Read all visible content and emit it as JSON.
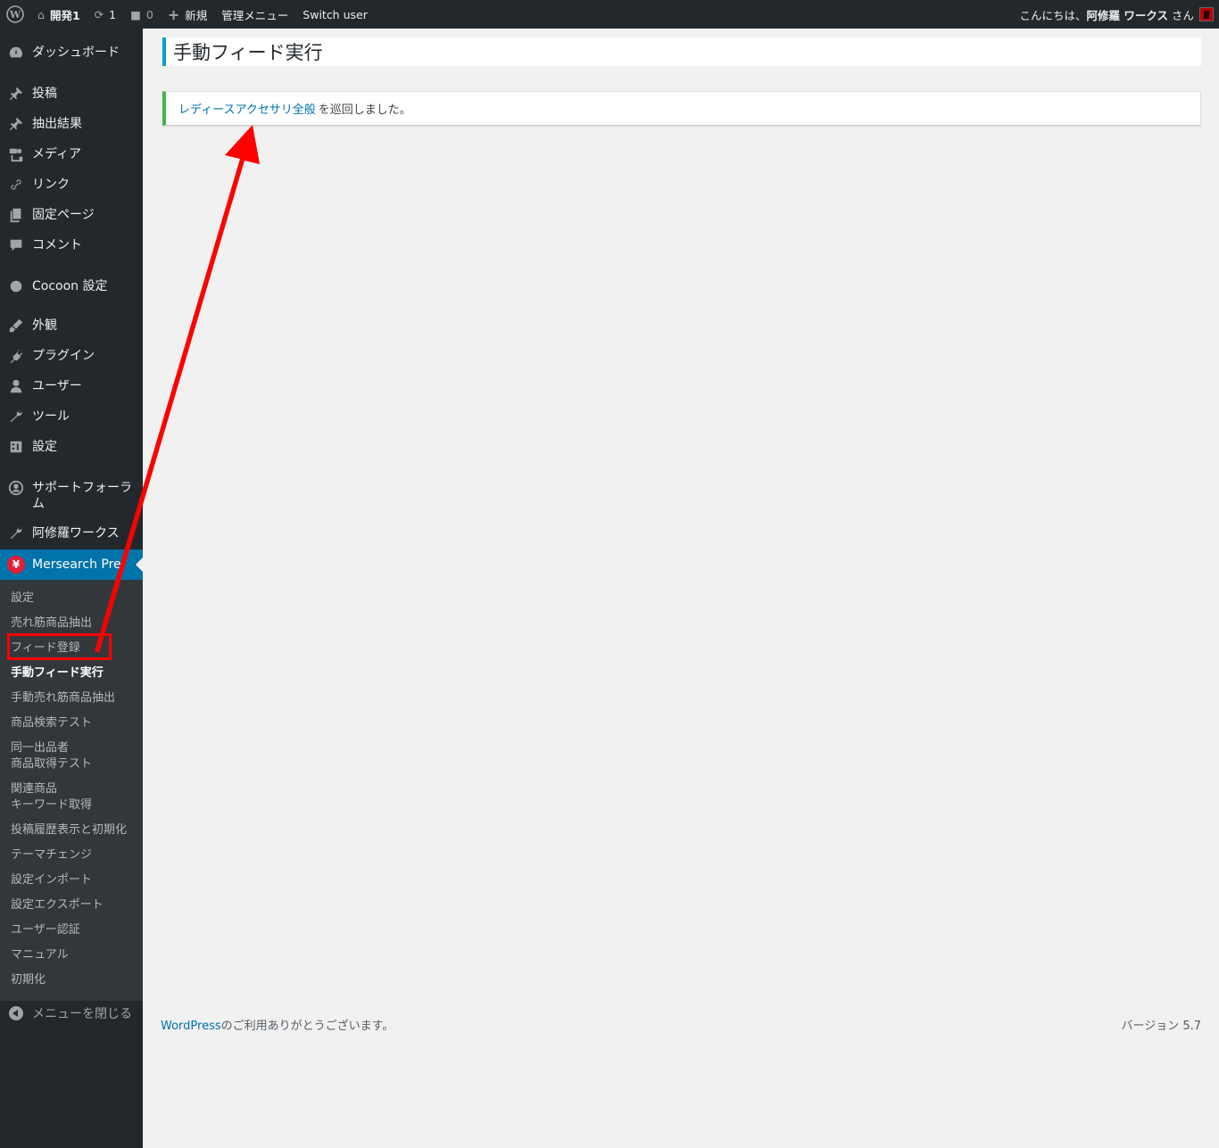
{
  "adminbar": {
    "site_name": "開発1",
    "updates_count": "1",
    "comments_count": "0",
    "new_label": "新規",
    "admin_menu_label": "管理メニュー",
    "switch_user_label": "Switch user",
    "greeting": "こんにちは、",
    "user_name": "阿修羅 ワークス",
    "greeting_suffix": "さん"
  },
  "sidebar": {
    "items": [
      {
        "label": "ダッシュボード",
        "icon": "dashboard-icon"
      },
      {
        "label": "投稿",
        "icon": "pin-icon"
      },
      {
        "label": "抽出結果",
        "icon": "pin-icon"
      },
      {
        "label": "メディア",
        "icon": "media-icon"
      },
      {
        "label": "リンク",
        "icon": "link-icon"
      },
      {
        "label": "固定ページ",
        "icon": "page-icon"
      },
      {
        "label": "コメント",
        "icon": "comment-icon"
      },
      {
        "label": "Cocoon 設定",
        "icon": "circle-icon"
      },
      {
        "label": "外観",
        "icon": "appearance-icon"
      },
      {
        "label": "プラグイン",
        "icon": "plugin-icon"
      },
      {
        "label": "ユーザー",
        "icon": "user-icon"
      },
      {
        "label": "ツール",
        "icon": "tool-icon"
      },
      {
        "label": "設定",
        "icon": "settings-icon"
      },
      {
        "label": "サポートフォーラム",
        "icon": "support-icon"
      },
      {
        "label": "阿修羅ワークス",
        "icon": "wrench-icon"
      }
    ],
    "current": {
      "label": "Mersearch Press",
      "icon_text": "¥"
    },
    "submenu": [
      "設定",
      "売れ筋商品抽出",
      "フィード登録",
      "手動フィード実行",
      "手動売れ筋商品抽出",
      "商品検索テスト",
      "同一出品者",
      "商品取得テスト",
      "関連商品",
      "キーワード取得",
      "投稿履歴表示と初期化",
      "テーマチェンジ",
      "設定インポート",
      "設定エクスポート",
      "ユーザー認証",
      "マニュアル",
      "初期化"
    ],
    "collapse_label": "メニューを閉じる"
  },
  "main": {
    "title": "手動フィード実行",
    "notice": {
      "link_text": "レディースアクセサリ全般",
      "message": "を巡回しました。"
    }
  },
  "footer": {
    "wp_link": "WordPress",
    "thanks": "のご利用ありがとうございます。",
    "version": "バージョン 5.7"
  },
  "colors": {
    "adminbar_bg": "#23282d",
    "submenu_bg": "#32373c",
    "accent": "#0073aa",
    "notice_success": "#46b450",
    "title_bar": "#00a0d2",
    "annotation": "#ff0000"
  }
}
